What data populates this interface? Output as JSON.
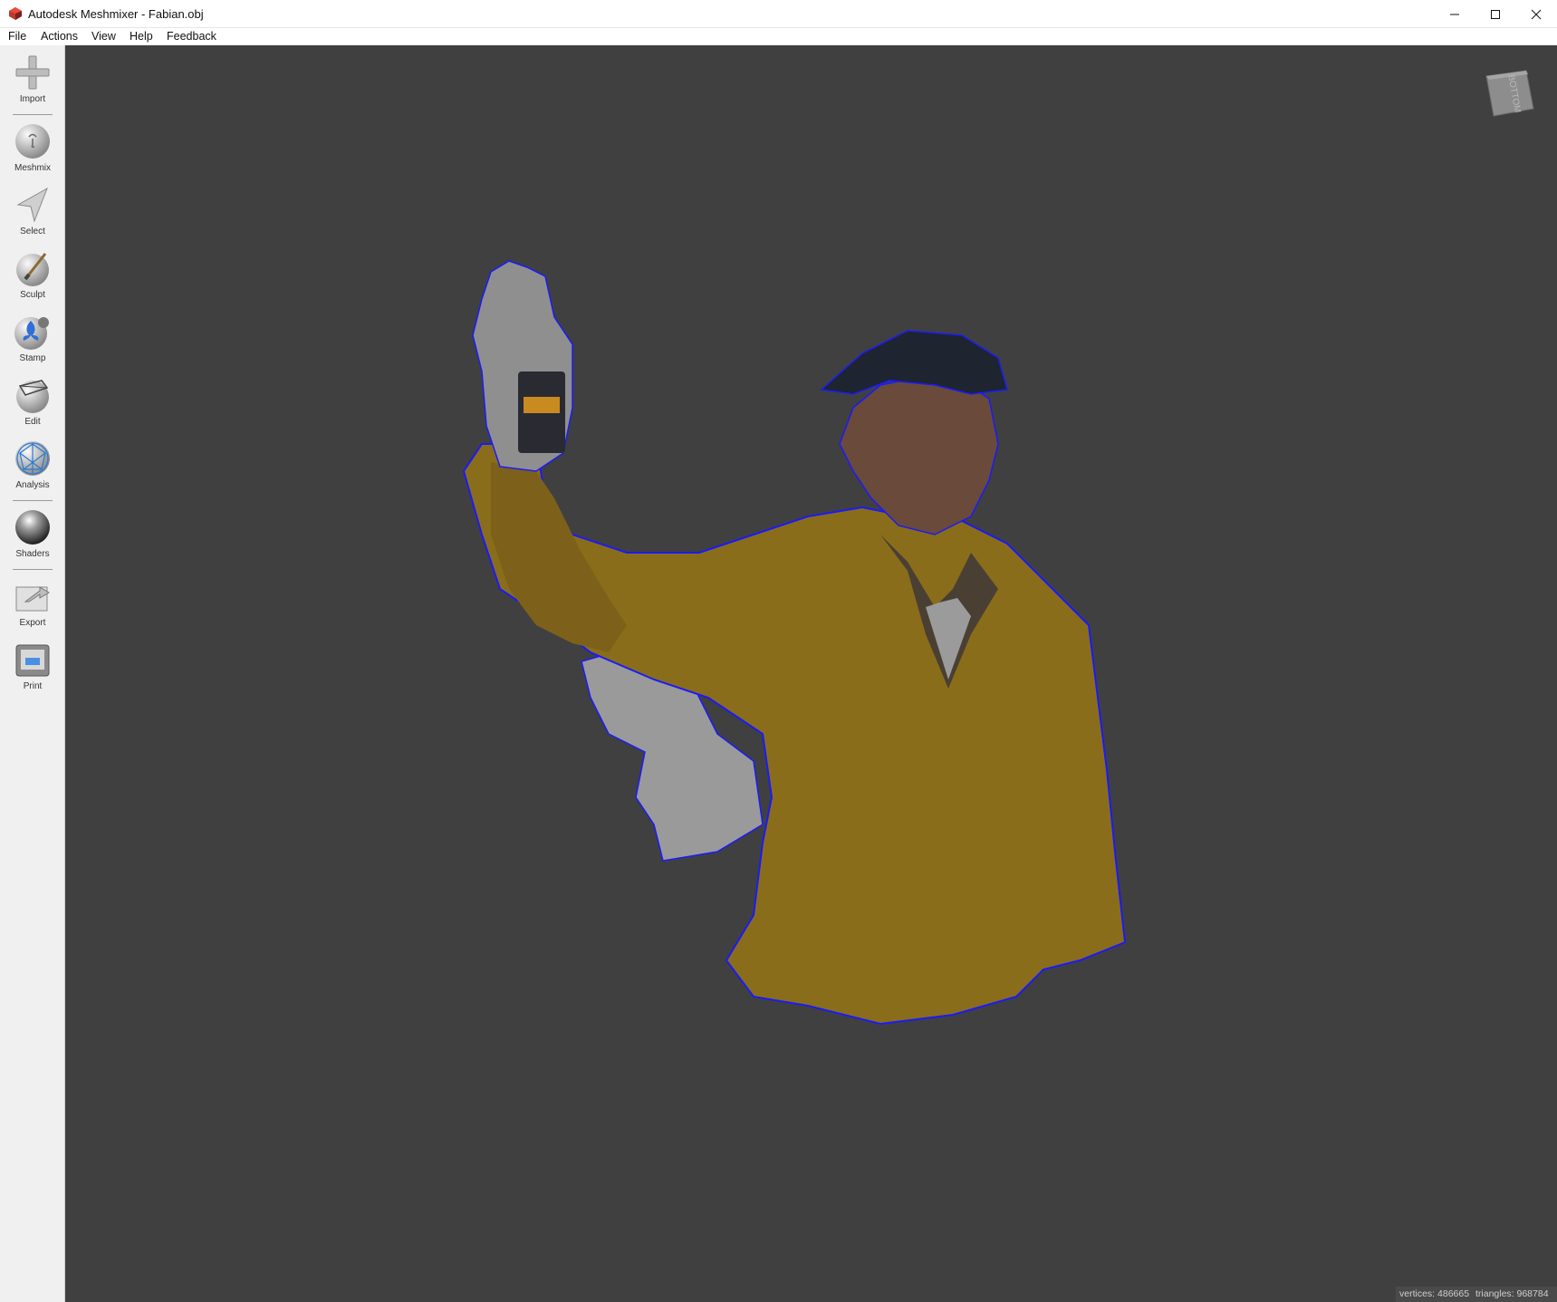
{
  "window": {
    "title": "Autodesk Meshmixer - Fabian.obj"
  },
  "menu": {
    "items": [
      "File",
      "Actions",
      "View",
      "Help",
      "Feedback"
    ]
  },
  "sidebar": {
    "tools": [
      {
        "label": "Import",
        "icon": "import-icon"
      },
      {
        "label": "Meshmix",
        "icon": "meshmix-icon"
      },
      {
        "label": "Select",
        "icon": "select-icon"
      },
      {
        "label": "Sculpt",
        "icon": "sculpt-icon"
      },
      {
        "label": "Stamp",
        "icon": "stamp-icon"
      },
      {
        "label": "Edit",
        "icon": "edit-icon"
      },
      {
        "label": "Analysis",
        "icon": "analysis-icon"
      },
      {
        "label": "Shaders",
        "icon": "shaders-icon"
      },
      {
        "label": "Export",
        "icon": "export-icon"
      },
      {
        "label": "Print",
        "icon": "print-icon"
      }
    ]
  },
  "viewport": {
    "viewcube_face": "BOTTOM",
    "background_color": "#404040",
    "mesh_boundary_color": "#1a1aff"
  },
  "status": {
    "vertices": "vertices: 486665",
    "triangles": "triangles: 968784"
  }
}
